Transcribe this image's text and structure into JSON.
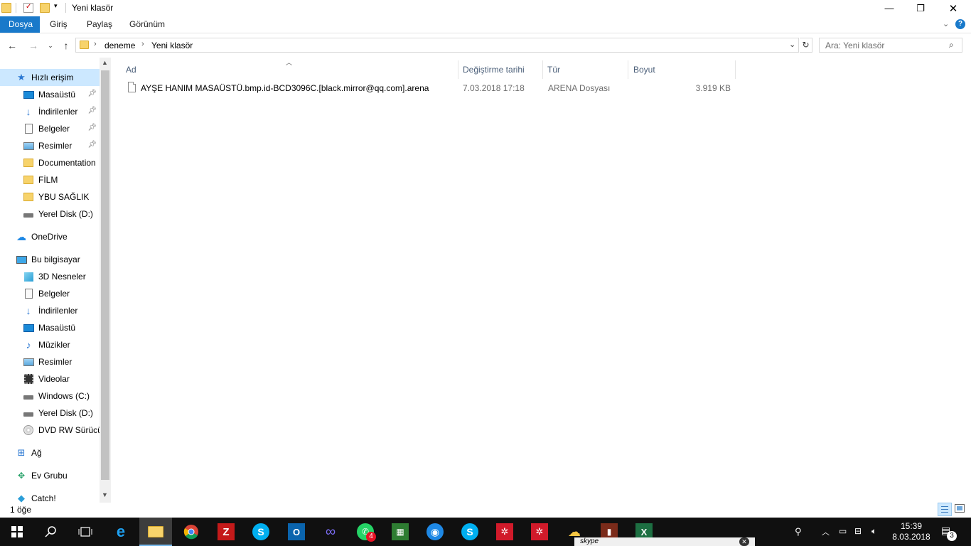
{
  "window": {
    "title": "Yeni klasör",
    "controls": {
      "minimize": "—",
      "maximize": "❐",
      "close": "✕"
    }
  },
  "ribbon": {
    "tabs": [
      "Dosya",
      "Giriş",
      "Paylaş",
      "Görünüm"
    ],
    "active_tab": "Dosya"
  },
  "address": {
    "breadcrumb": [
      "deneme",
      "Yeni klasör"
    ],
    "search_placeholder": "Ara: Yeni klasör"
  },
  "nav": {
    "items": [
      {
        "label": "Hızlı erişim",
        "icon": "star-icon",
        "pinned": false,
        "selected": true
      },
      {
        "label": "Masaüstü",
        "icon": "desktop-icon",
        "pinned": true
      },
      {
        "label": "İndirilenler",
        "icon": "download-icon",
        "pinned": true
      },
      {
        "label": "Belgeler",
        "icon": "document-icon",
        "pinned": true
      },
      {
        "label": "Resimler",
        "icon": "pictures-icon",
        "pinned": true
      },
      {
        "label": "Documentation",
        "icon": "folder-icon",
        "pinned": false
      },
      {
        "label": "FİLM",
        "icon": "folder-icon",
        "pinned": false
      },
      {
        "label": "YBU SAĞLIK",
        "icon": "folder-icon",
        "pinned": false
      },
      {
        "label": "Yerel Disk (D:)",
        "icon": "drive-icon",
        "pinned": false
      },
      {
        "label": "OneDrive",
        "icon": "cloud-icon",
        "pinned": false
      },
      {
        "label": "Bu bilgisayar",
        "icon": "computer-icon",
        "pinned": false
      },
      {
        "label": "3D Nesneler",
        "icon": "cube-icon",
        "pinned": false
      },
      {
        "label": "Belgeler",
        "icon": "document-icon",
        "pinned": false
      },
      {
        "label": "İndirilenler",
        "icon": "download-icon",
        "pinned": false
      },
      {
        "label": "Masaüstü",
        "icon": "desktop-icon",
        "pinned": false
      },
      {
        "label": "Müzikler",
        "icon": "music-icon",
        "pinned": false
      },
      {
        "label": "Resimler",
        "icon": "pictures-icon",
        "pinned": false
      },
      {
        "label": "Videolar",
        "icon": "video-icon",
        "pinned": false
      },
      {
        "label": "Windows (C:)",
        "icon": "drive-icon",
        "pinned": false
      },
      {
        "label": "Yerel Disk (D:)",
        "icon": "drive-icon",
        "pinned": false
      },
      {
        "label": "DVD RW Sürücüsü",
        "icon": "dvd-icon",
        "pinned": false
      },
      {
        "label": "Ağ",
        "icon": "network-icon",
        "pinned": false
      },
      {
        "label": "Ev Grubu",
        "icon": "homegroup-icon",
        "pinned": false
      },
      {
        "label": "Catch!",
        "icon": "catch-icon",
        "pinned": false
      }
    ]
  },
  "content": {
    "columns": [
      "Ad",
      "Değiştirme tarihi",
      "Tür",
      "Boyut"
    ],
    "rows": [
      {
        "name": "AYŞE HANIM MASAÜSTÜ.bmp.id-BCD3096C.[black.mirror@qq.com].arena",
        "modified": "7.03.2018 17:18",
        "type": "ARENA Dosyası",
        "size": "3.919 KB"
      }
    ]
  },
  "status": {
    "item_count": "1 öğe"
  },
  "taskbar": {
    "clock_time": "15:39",
    "clock_date": "8.03.2018",
    "notification_count": "3",
    "whatsapp_badge": "4",
    "skype_preview": "skype"
  }
}
